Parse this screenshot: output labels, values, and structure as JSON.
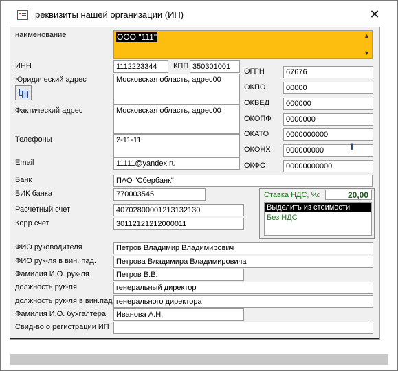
{
  "window": {
    "title": "реквизиты нашей организации (ИП)",
    "close_label": "✕"
  },
  "name": {
    "label": "наименование",
    "value": "ООО \"111\""
  },
  "left": {
    "inn_label": "ИНН",
    "inn": "1112223344",
    "kpp_label": "КПП",
    "kpp": "350301001",
    "legal_addr_label": "Юридический адрес",
    "legal_addr": "Московская область, адрес00",
    "actual_addr_label": "Фактический адрес",
    "actual_addr": "Московская область, адрес00",
    "phones_label": "Телефоны",
    "phones": "2-11-11",
    "email_label": "Email",
    "email": "11111@yandex.ru",
    "bank_label": "Банк",
    "bank": "ПАО \"Сбербанк\"",
    "bik_label": "БИК банка",
    "bik": "770003545",
    "account_label": "Расчетный счет",
    "account": "40702800001213132130",
    "corr_label": "Корр счет",
    "corr": "30112121212000011"
  },
  "right": {
    "ogrn_label": "ОГРН",
    "ogrn": "67676",
    "okpo_label": "ОКПО",
    "okpo": "00000",
    "okved_label": "ОКВЕД",
    "okved": "000000",
    "okopf_label": "ОКОПФ",
    "okopf": "0000000",
    "okato_label": "ОКАТО",
    "okato": "0000000000",
    "okonh_label": "ОКОНХ",
    "okonh": "000000000",
    "okfs_label": "ОКФС",
    "okfs": "00000000000"
  },
  "vat": {
    "label": "Ставка НДС, %:",
    "value": "20,00",
    "options": [
      "Выделить из стоимости",
      "Без НДС"
    ]
  },
  "people": {
    "head_fio_label": "ФИО руководителя",
    "head_fio": "Петров Владимир Владимирович",
    "head_fio_gen_label": "ФИО рук-ля в вин. пад.",
    "head_fio_gen": "Петрова Владимира Владимировича",
    "head_short_label": "Фамилия И.О. рук-ля",
    "head_short": "Петров В.В.",
    "head_pos_label": "должность рук-ля",
    "head_pos": "генеральный директор",
    "head_pos_gen_label": "должность рук-ля в вин.пад",
    "head_pos_gen": "генерального директора",
    "accountant_label": "Фамилия И.О. бухгалтера",
    "accountant": "Иванова А.Н.",
    "cert_label": "Свид-во о регистрации ИП",
    "cert": ""
  }
}
